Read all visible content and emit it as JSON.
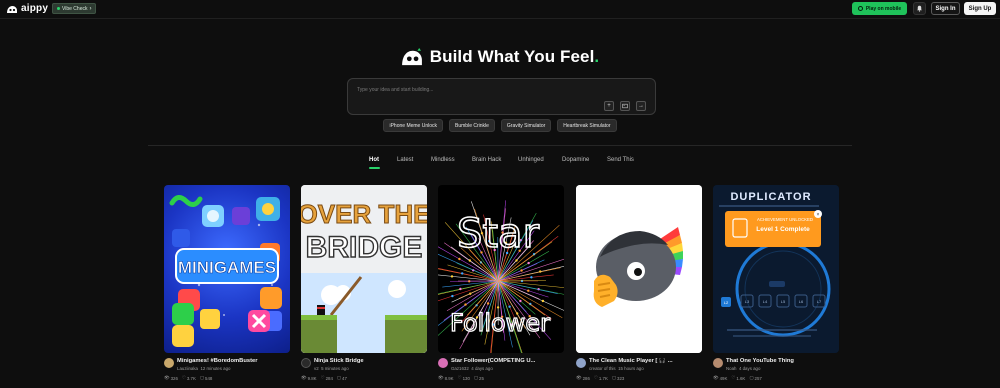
{
  "header": {
    "logo_text": "aippy",
    "vibe_check_label": "Vibe Check",
    "play_mobile_label": "Play on mobile",
    "sign_in_label": "Sign In",
    "sign_up_label": "Sign Up"
  },
  "hero": {
    "title": "Build What You Feel",
    "title_dot": "."
  },
  "prompt": {
    "placeholder": "Type your idea and start building..."
  },
  "suggestions": [
    "iPhone Meme Unlock",
    "Bumble Crinkle",
    "Gravity Simulator",
    "Heartbreak Simulator"
  ],
  "tabs": [
    {
      "label": "Hot",
      "active": true
    },
    {
      "label": "Latest",
      "active": false
    },
    {
      "label": "Mindless",
      "active": false
    },
    {
      "label": "Brain Hack",
      "active": false
    },
    {
      "label": "Unhinged",
      "active": false
    },
    {
      "label": "Dopamine",
      "active": false
    },
    {
      "label": "Send This",
      "active": false
    }
  ],
  "cards": [
    {
      "title": "Minigames! #BoredomBuster",
      "author": "Lauziinaka",
      "time": "12 minutes ago",
      "views": "326",
      "likes": "3.7K",
      "comments": "548",
      "thumb_text": "MINIGAMES"
    },
    {
      "title": "Ninja Stick Bridge",
      "author": "v2",
      "time": "5 minutes ago",
      "views": "9.8K",
      "likes": "284",
      "comments": "47",
      "thumb_text_1": "OVER THE",
      "thumb_text_2": "BRIDGE"
    },
    {
      "title": "Star Follower(COMPETING U...",
      "author": "Gaz1632",
      "time": "4 days ago",
      "views": "8.9K",
      "likes": "130",
      "comments": "25",
      "thumb_text_1": "Star",
      "thumb_text_2": "Follower"
    },
    {
      "title": "The Clean Music Player [ 🎧 ...",
      "author": "creator of this",
      "time": "15 hours ago",
      "views": "286",
      "likes": "1.7K",
      "comments": "323"
    },
    {
      "title": "That One YouTube Thing",
      "author": "Noah",
      "time": "4 days ago",
      "views": "49K",
      "likes": "1.6K",
      "comments": "257",
      "thumb_title": "DUPLICATOR",
      "thumb_subtitle": "ACHIEVEMENT UNLOCKED",
      "thumb_level": "Level 1 Complete",
      "level_buttons": [
        "L2",
        "L3",
        "L4",
        "L5",
        "L6",
        "L7"
      ]
    }
  ],
  "colors": {
    "accent": "#29d36a",
    "background": "#0e0e0e"
  }
}
